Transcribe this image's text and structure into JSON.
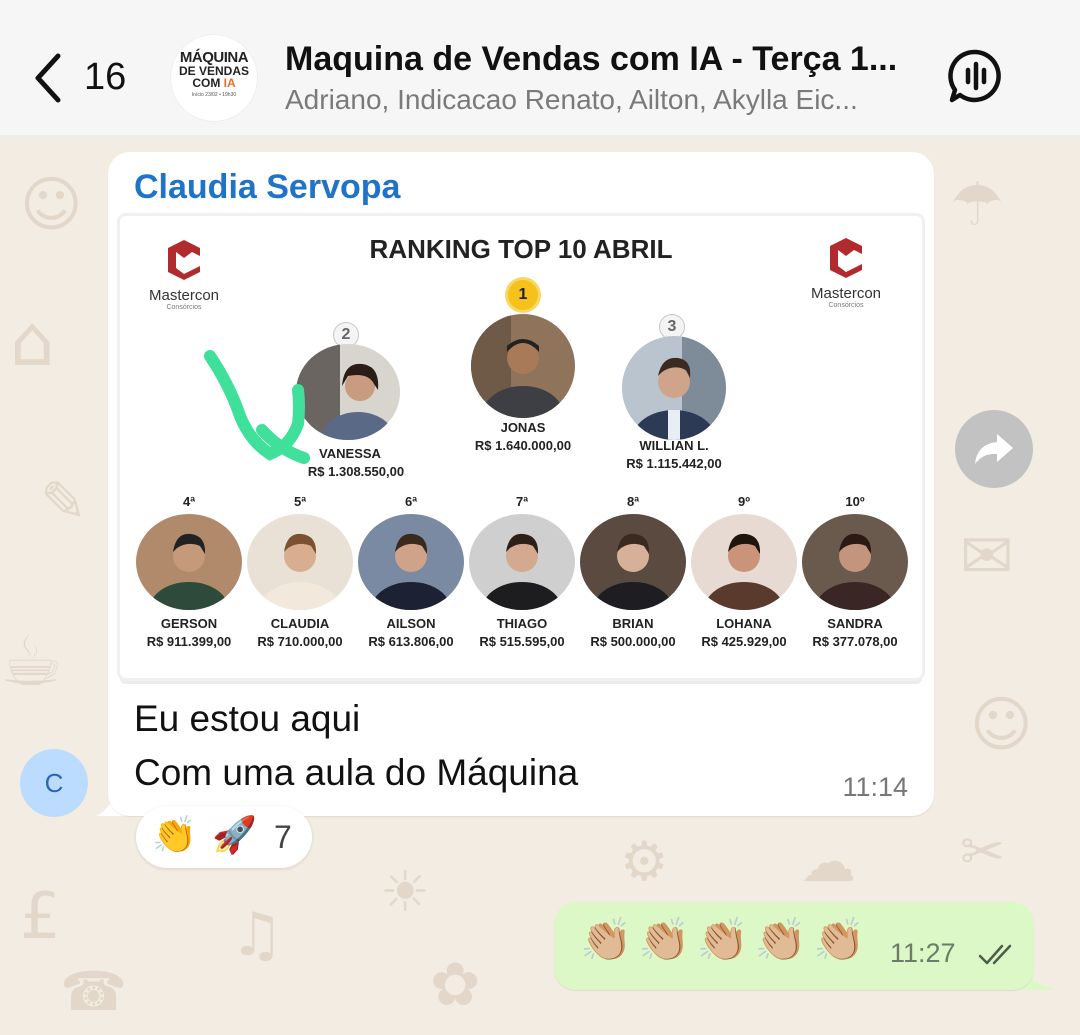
{
  "header": {
    "back_count": "16",
    "group_avatar": {
      "l1": "MÁQUINA",
      "l2": "DE VENDAS",
      "l3a": "COM ",
      "l3b": "IA",
      "l4": "Início 23/02 • 19h30"
    },
    "title": "Maquina de Vendas com IA - Terça 1...",
    "subtitle": "Adriano, Indicacao Renato, Ailton, Akylla Eic..."
  },
  "message_in": {
    "sender": "Claudia Servopa",
    "avatar_letter": "C",
    "image": {
      "title": "RANKING TOP 10 ABRIL",
      "logo_name": "Mastercon",
      "logo_sub": "Consórcios",
      "top3": [
        {
          "medal": "1",
          "name": "JONAS",
          "value": "R$ 1.640.000,00"
        },
        {
          "medal": "2",
          "name": "VANESSA",
          "value": "R$ 1.308.550,00"
        },
        {
          "medal": "3",
          "name": "WILLIAN L.",
          "value": "R$ 1.115.442,00"
        }
      ],
      "others": [
        {
          "rank": "4ª",
          "name": "GERSON",
          "value": "R$ 911.399,00"
        },
        {
          "rank": "5ª",
          "name": "CLAUDIA",
          "value": "R$ 710.000,00"
        },
        {
          "rank": "6ª",
          "name": "AILSON",
          "value": "R$ 613.806,00"
        },
        {
          "rank": "7ª",
          "name": "THIAGO",
          "value": "R$ 515.595,00"
        },
        {
          "rank": "8ª",
          "name": "BRIAN",
          "value": "R$ 500.000,00"
        },
        {
          "rank": "9º",
          "name": "LOHANA",
          "value": "R$ 425.929,00"
        },
        {
          "rank": "10º",
          "name": "SANDRA",
          "value": "R$ 377.078,00"
        }
      ]
    },
    "text_line1": "Eu estou aqui",
    "text_line2": "Com uma aula do Máquina",
    "time": "11:14",
    "reactions": {
      "emoji1": "👏",
      "emoji2": "🚀",
      "count": "7"
    }
  },
  "message_out": {
    "text": "👏🏼👏🏼👏🏼👏🏼👏🏼",
    "time": "11:27"
  },
  "colors": {
    "sender": "#1f73c9",
    "outgoing_bubble": "#dcf8c6",
    "wallpaper": "#f3ece2",
    "highlight_arrow": "#3ee09a"
  },
  "icons": [
    "back-chevron-icon",
    "audio-call-icon",
    "forward-icon",
    "double-check-icon",
    "mastercon-logo"
  ]
}
